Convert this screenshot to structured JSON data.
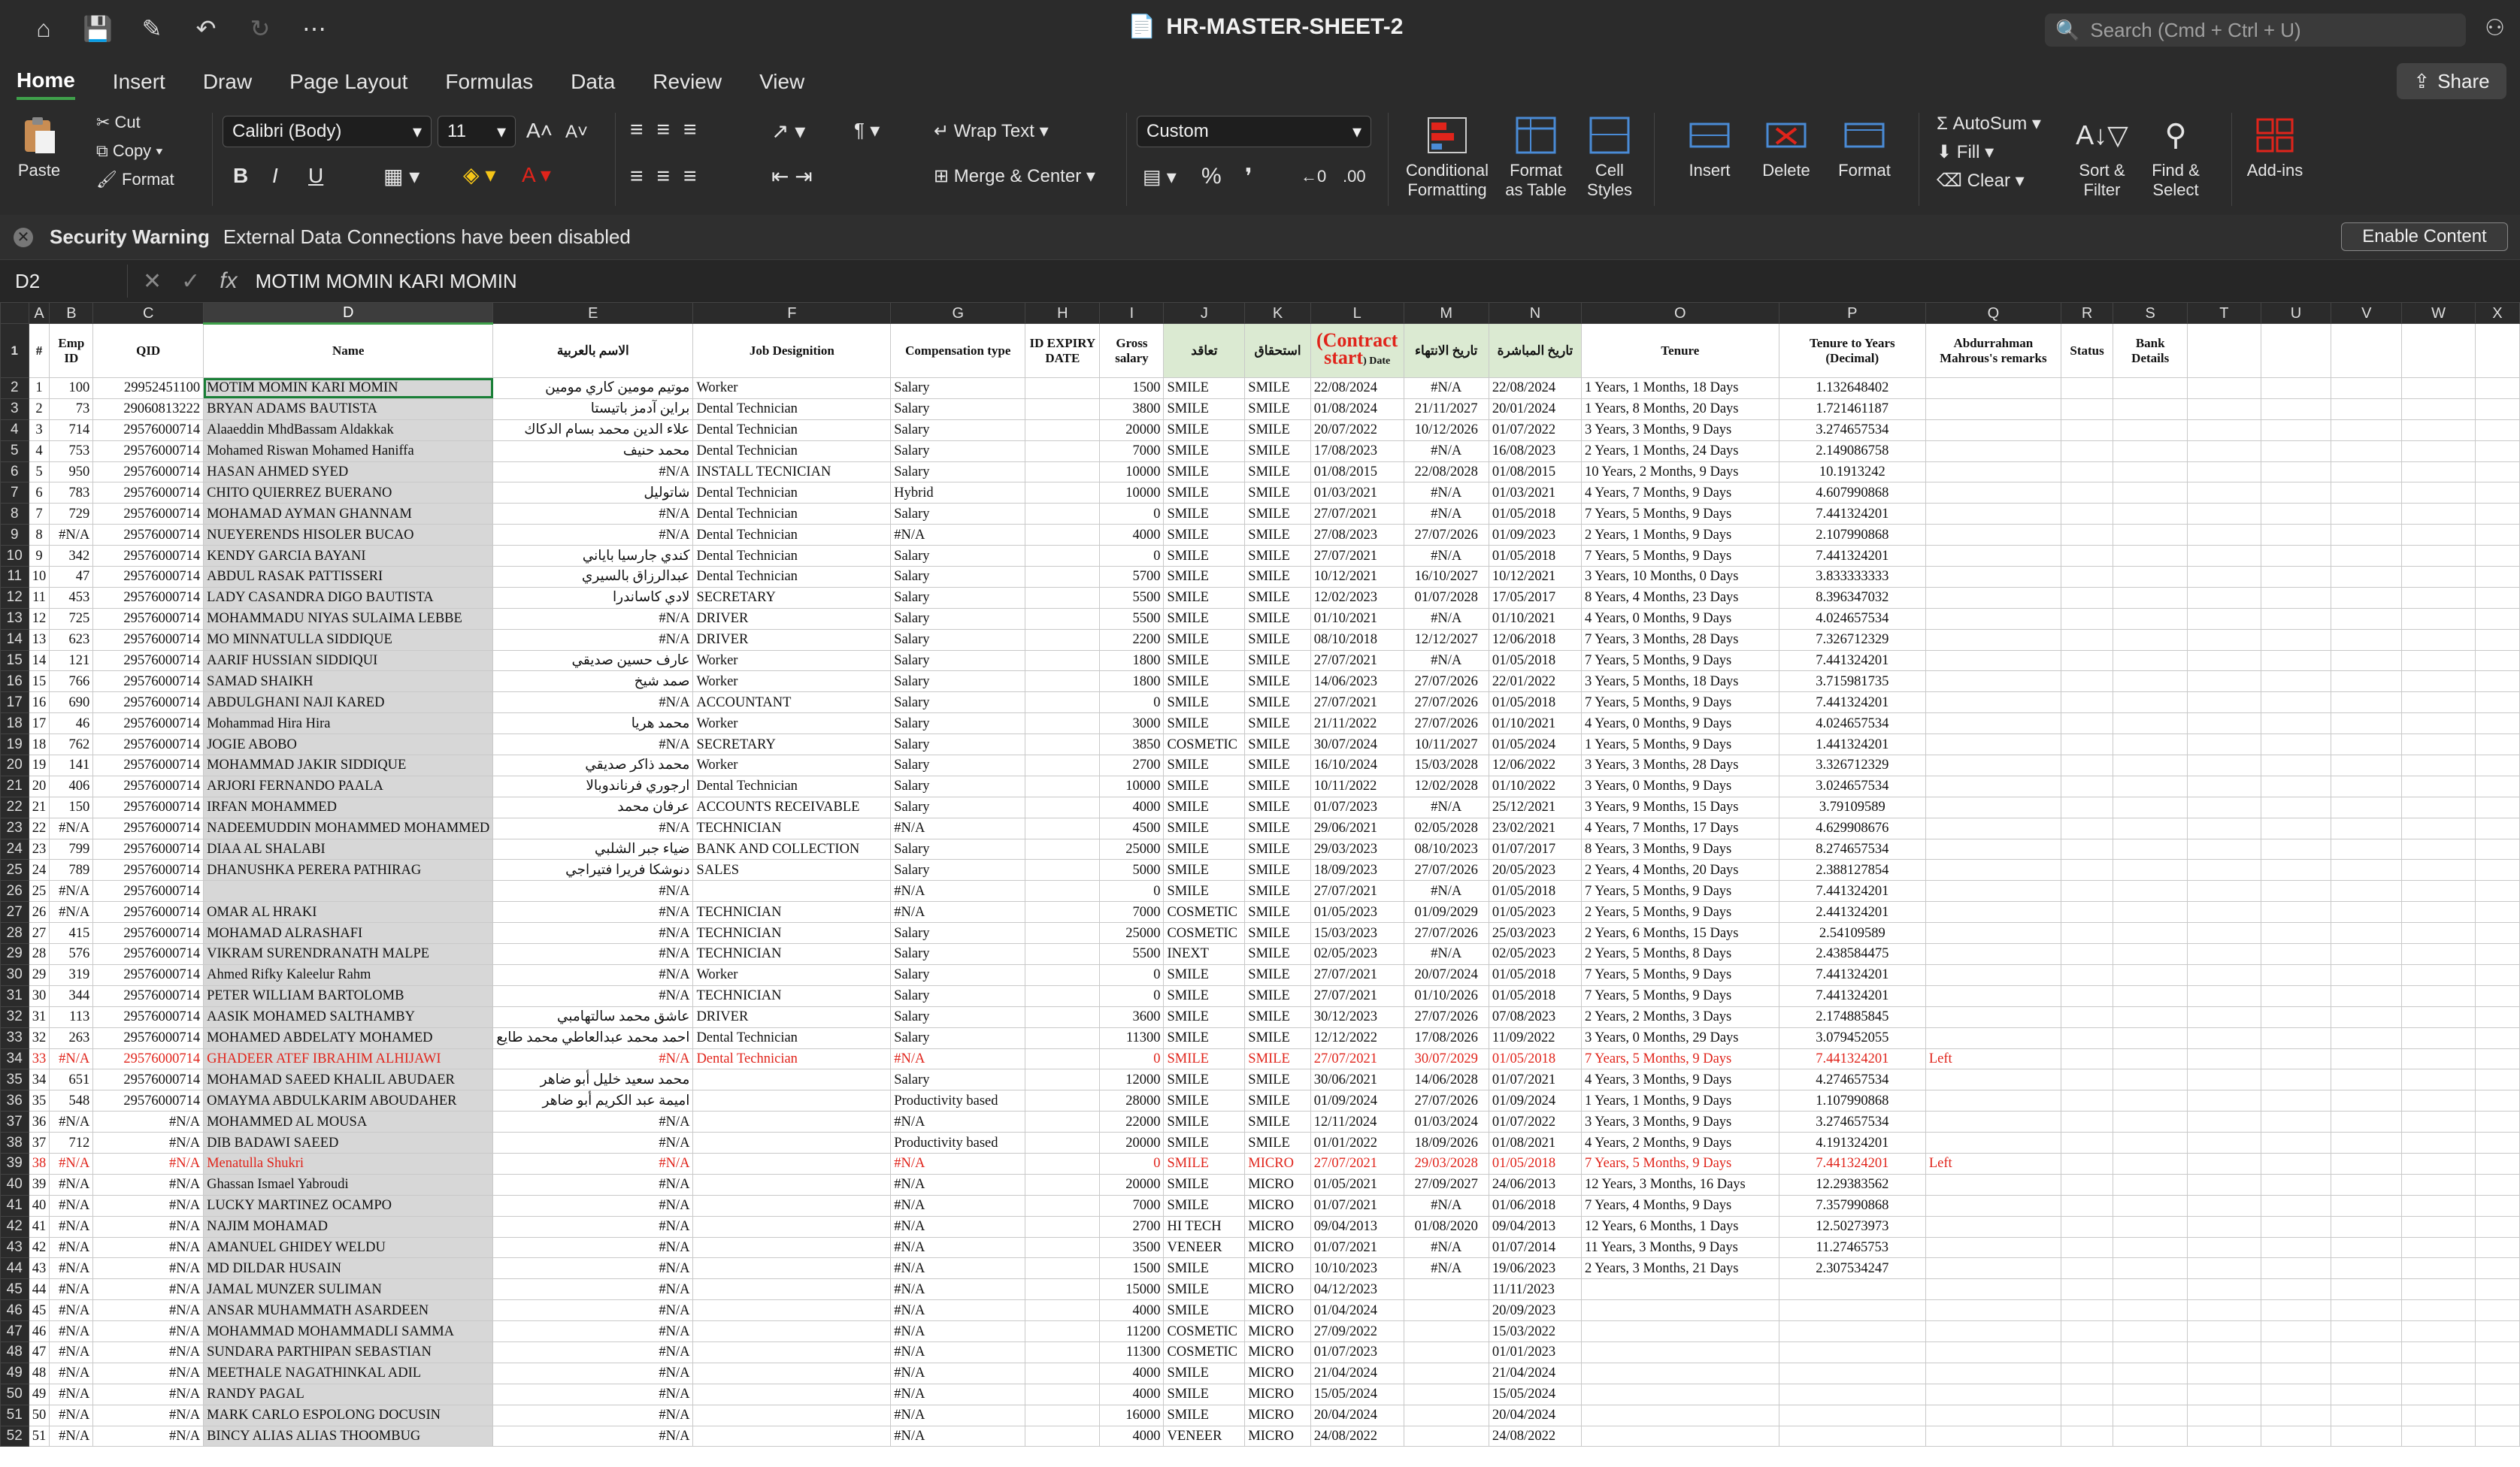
{
  "window": {
    "title": "HR-MASTER-SHEET-2",
    "search_placeholder": "Search (Cmd + Ctrl + U)"
  },
  "menu_tabs": [
    "Home",
    "Insert",
    "Draw",
    "Page Layout",
    "Formulas",
    "Data",
    "Review",
    "View"
  ],
  "share_label": "Share",
  "ribbon": {
    "paste": "Paste",
    "cut": "Cut",
    "copy": "Copy",
    "format_painter": "Format",
    "font_name": "Calibri (Body)",
    "font_size": "11",
    "wrap_text": "Wrap Text",
    "merge_center": "Merge & Center",
    "number_format": "Custom",
    "conditional_formatting": "Conditional Formatting",
    "format_as_table": "Format as Table",
    "cell_styles": "Cell Styles",
    "insert": "Insert",
    "delete": "Delete",
    "format": "Format",
    "autosum": "AutoSum",
    "fill": "Fill",
    "clear": "Clear",
    "sort_filter": "Sort & Filter",
    "find_select": "Find & Select",
    "addins": "Add-ins",
    "bold": "B",
    "italic": "I",
    "underline": "U"
  },
  "security": {
    "title": "Security Warning",
    "message": "External Data Connections have been disabled",
    "button": "Enable Content"
  },
  "formula_bar": {
    "cell": "D2",
    "formula": "MOTIM MOMIN KARI MOMIN"
  },
  "columns": [
    "A",
    "B",
    "C",
    "D",
    "E",
    "F",
    "G",
    "H",
    "I",
    "J",
    "K",
    "L",
    "M",
    "N",
    "O",
    "P",
    "Q",
    "R",
    "S",
    "T",
    "U",
    "V",
    "W",
    "X"
  ],
  "headers": {
    "A": "#",
    "B": "Emp ID",
    "C": "QID",
    "D": "Name",
    "E": "الاسم بالعربية",
    "F": "Job Designition",
    "G": "Compensation type",
    "H": "ID EXPIRY DATE",
    "I": "Gross salary",
    "J": "تعاقد",
    "K": "استحقاق",
    "L_big": "(Contract start",
    "L_small": ") Date",
    "M": "تاريخ الانتهاء",
    "N": "تاريخ المباشرة",
    "O": "Tenure",
    "P": "Tenure to Years (Decimal)",
    "Q": "Abdurrahman Mahrous's remarks",
    "R": "Status",
    "S": "Bank Details"
  },
  "rows": [
    [
      "1",
      "100",
      "29952451100",
      "MOTIM MOMIN KARI MOMIN",
      "موتيم مومين كاري مومين",
      "Worker",
      "Salary",
      "",
      "1500",
      "SMILE",
      "SMILE",
      "22/08/2024",
      "#N/A",
      "22/08/2024",
      "1 Years, 1 Months, 18 Days",
      "1.132648402",
      "",
      "",
      ""
    ],
    [
      "2",
      "73",
      "29060813222",
      "BRYAN ADAMS BAUTISTA",
      "براين آدمز باتيستا",
      "Dental Technician",
      "Salary",
      "",
      "3800",
      "SMILE",
      "SMILE",
      "01/08/2024",
      "21/11/2027",
      "20/01/2024",
      "1 Years, 8 Months, 20 Days",
      "1.721461187",
      "",
      "",
      ""
    ],
    [
      "3",
      "714",
      "29576000714",
      "Alaaeddin MhdBassam Aldakkak",
      "علاء الدين محمد بسام الدكاك",
      "Dental Technician",
      "Salary",
      "",
      "20000",
      "SMILE",
      "SMILE",
      "20/07/2022",
      "10/12/2026",
      "01/07/2022",
      "3 Years, 3 Months, 9 Days",
      "3.274657534",
      "",
      "",
      ""
    ],
    [
      "4",
      "753",
      "29576000714",
      "Mohamed Riswan Mohamed Haniffa",
      "محمد حنيف",
      "Dental Technician",
      "Salary",
      "",
      "7000",
      "SMILE",
      "SMILE",
      "17/08/2023",
      "#N/A",
      "16/08/2023",
      "2 Years, 1 Months, 24 Days",
      "2.149086758",
      "",
      "",
      ""
    ],
    [
      "5",
      "950",
      "29576000714",
      "HASAN AHMED SYED",
      "#N/A",
      "INSTALL TECNICIAN",
      "Salary",
      "",
      "10000",
      "SMILE",
      "SMILE",
      "01/08/2015",
      "22/08/2028",
      "01/08/2015",
      "10 Years, 2 Months, 9 Days",
      "10.1913242",
      "",
      "",
      ""
    ],
    [
      "6",
      "783",
      "29576000714",
      "CHITO QUIERREZ BUERANO",
      "شاتوليل",
      "Dental Technician",
      "Hybrid",
      "",
      "10000",
      "SMILE",
      "SMILE",
      "01/03/2021",
      "#N/A",
      "01/03/2021",
      "4 Years, 7 Months, 9 Days",
      "4.607990868",
      "",
      "",
      ""
    ],
    [
      "7",
      "729",
      "29576000714",
      "MOHAMAD AYMAN GHANNAM",
      "#N/A",
      "Dental Technician",
      "Salary",
      "",
      "0",
      "SMILE",
      "SMILE",
      "27/07/2021",
      "#N/A",
      "01/05/2018",
      "7 Years, 5 Months, 9 Days",
      "7.441324201",
      "",
      "",
      ""
    ],
    [
      "8",
      "#N/A",
      "29576000714",
      "NUEYERENDS HISOLER BUCAO",
      "#N/A",
      "Dental Technician",
      "#N/A",
      "",
      "4000",
      "SMILE",
      "SMILE",
      "27/08/2023",
      "27/07/2026",
      "01/09/2023",
      "2 Years, 1 Months, 9 Days",
      "2.107990868",
      "",
      "",
      ""
    ],
    [
      "9",
      "342",
      "29576000714",
      "KENDY GARCIA BAYANI",
      "كندي جارسيا باياني",
      "Dental Technician",
      "Salary",
      "",
      "0",
      "SMILE",
      "SMILE",
      "27/07/2021",
      "#N/A",
      "01/05/2018",
      "7 Years, 5 Months, 9 Days",
      "7.441324201",
      "",
      "",
      ""
    ],
    [
      "10",
      "47",
      "29576000714",
      "ABDUL RASAK PATTISSERI",
      "عبدالرزاق بالسيري",
      "Dental Technician",
      "Salary",
      "",
      "5700",
      "SMILE",
      "SMILE",
      "10/12/2021",
      "16/10/2027",
      "10/12/2021",
      "3 Years, 10 Months, 0 Days",
      "3.833333333",
      "",
      "",
      ""
    ],
    [
      "11",
      "453",
      "29576000714",
      "LADY CASANDRA DIGO BAUTISTA",
      "لادي كاساندرا",
      "SECRETARY",
      "Salary",
      "",
      "5500",
      "SMILE",
      "SMILE",
      "12/02/2023",
      "01/07/2028",
      "17/05/2017",
      "8 Years, 4 Months, 23 Days",
      "8.396347032",
      "",
      "",
      ""
    ],
    [
      "12",
      "725",
      "29576000714",
      "MOHAMMADU NIYAS SULAIMA LEBBE",
      "#N/A",
      "DRIVER",
      "Salary",
      "",
      "5500",
      "SMILE",
      "SMILE",
      "01/10/2021",
      "#N/A",
      "01/10/2021",
      "4 Years, 0 Months, 9 Days",
      "4.024657534",
      "",
      "",
      ""
    ],
    [
      "13",
      "623",
      "29576000714",
      "MO MINNATULLA SIDDIQUE",
      "#N/A",
      "DRIVER",
      "Salary",
      "",
      "2200",
      "SMILE",
      "SMILE",
      "08/10/2018",
      "12/12/2027",
      "12/06/2018",
      "7 Years, 3 Months, 28 Days",
      "7.326712329",
      "",
      "",
      ""
    ],
    [
      "14",
      "121",
      "29576000714",
      "AARIF HUSSIAN SIDDIQUI",
      "عارف حسين صديقي",
      "Worker",
      "Salary",
      "",
      "1800",
      "SMILE",
      "SMILE",
      "27/07/2021",
      "#N/A",
      "01/05/2018",
      "7 Years, 5 Months, 9 Days",
      "7.441324201",
      "",
      "",
      ""
    ],
    [
      "15",
      "766",
      "29576000714",
      "SAMAD SHAIKH",
      "صمد شيخ",
      "Worker",
      "Salary",
      "",
      "1800",
      "SMILE",
      "SMILE",
      "14/06/2023",
      "27/07/2026",
      "22/01/2022",
      "3 Years, 5 Months, 18 Days",
      "3.715981735",
      "",
      "",
      ""
    ],
    [
      "16",
      "690",
      "29576000714",
      "ABDULGHANI NAJI KARED",
      "#N/A",
      "ACCOUNTANT",
      "Salary",
      "",
      "0",
      "SMILE",
      "SMILE",
      "27/07/2021",
      "27/07/2026",
      "01/05/2018",
      "7 Years, 5 Months, 9 Days",
      "7.441324201",
      "",
      "",
      ""
    ],
    [
      "17",
      "46",
      "29576000714",
      "Mohammad Hira Hira",
      "محمد هريا",
      "Worker",
      "Salary",
      "",
      "3000",
      "SMILE",
      "SMILE",
      "21/11/2022",
      "27/07/2026",
      "01/10/2021",
      "4 Years, 0 Months, 9 Days",
      "4.024657534",
      "",
      "",
      ""
    ],
    [
      "18",
      "762",
      "29576000714",
      "JOGIE ABOBO",
      "#N/A",
      "SECRETARY",
      "Salary",
      "",
      "3850",
      "COSMETIC",
      "SMILE",
      "30/07/2024",
      "10/11/2027",
      "01/05/2024",
      "1 Years, 5 Months, 9 Days",
      "1.441324201",
      "",
      "",
      ""
    ],
    [
      "19",
      "141",
      "29576000714",
      "MOHAMMAD JAKIR SIDDIQUE",
      "محمد ذاكر صديقي",
      "Worker",
      "Salary",
      "",
      "2700",
      "SMILE",
      "SMILE",
      "16/10/2024",
      "15/03/2028",
      "12/06/2022",
      "3 Years, 3 Months, 28 Days",
      "3.326712329",
      "",
      "",
      ""
    ],
    [
      "20",
      "406",
      "29576000714",
      "ARJORI FERNANDO PAALA",
      "ارجوري فرناندوبالا",
      "Dental Technician",
      "Salary",
      "",
      "10000",
      "SMILE",
      "SMILE",
      "10/11/2022",
      "12/02/2028",
      "01/10/2022",
      "3 Years, 0 Months, 9 Days",
      "3.024657534",
      "",
      "",
      ""
    ],
    [
      "21",
      "150",
      "29576000714",
      "IRFAN MOHAMMED",
      "عرفان محمد",
      "ACCOUNTS RECEIVABLE",
      "Salary",
      "",
      "4000",
      "SMILE",
      "SMILE",
      "01/07/2023",
      "#N/A",
      "25/12/2021",
      "3 Years, 9 Months, 15 Days",
      "3.79109589",
      "",
      "",
      ""
    ],
    [
      "22",
      "#N/A",
      "29576000714",
      "NADEEMUDDIN MOHAMMED MOHAMMED",
      "#N/A",
      "TECHNICIAN",
      "#N/A",
      "",
      "4500",
      "SMILE",
      "SMILE",
      "29/06/2021",
      "02/05/2028",
      "23/02/2021",
      "4 Years, 7 Months, 17 Days",
      "4.629908676",
      "",
      "",
      ""
    ],
    [
      "23",
      "799",
      "29576000714",
      "DIAA AL SHALABI",
      "ضياء جبر الشلبي",
      "BANK AND COLLECTION",
      "Salary",
      "",
      "25000",
      "SMILE",
      "SMILE",
      "29/03/2023",
      "08/10/2023",
      "01/07/2017",
      "8 Years, 3 Months, 9 Days",
      "8.274657534",
      "",
      "",
      ""
    ],
    [
      "24",
      "789",
      "29576000714",
      "DHANUSHKA PERERA PATHIRAG",
      "دنوشكا فريرا فتيراجي",
      "SALES",
      "Salary",
      "",
      "5000",
      "SMILE",
      "SMILE",
      "18/09/2023",
      "27/07/2026",
      "20/05/2023",
      "2 Years, 4 Months, 20 Days",
      "2.388127854",
      "",
      "",
      ""
    ],
    [
      "25",
      "#N/A",
      "29576000714",
      "",
      "#N/A",
      "",
      "#N/A",
      "",
      "0",
      "SMILE",
      "SMILE",
      "27/07/2021",
      "#N/A",
      "01/05/2018",
      "7 Years, 5 Months, 9 Days",
      "7.441324201",
      "",
      "",
      ""
    ],
    [
      "26",
      "#N/A",
      "29576000714",
      "OMAR AL HRAKI",
      "#N/A",
      "TECHNICIAN",
      "#N/A",
      "",
      "7000",
      "COSMETIC",
      "SMILE",
      "01/05/2023",
      "01/09/2029",
      "01/05/2023",
      "2 Years, 5 Months, 9 Days",
      "2.441324201",
      "",
      "",
      ""
    ],
    [
      "27",
      "415",
      "29576000714",
      "MOHAMAD ALRASHAFI",
      "#N/A",
      "TECHNICIAN",
      "Salary",
      "",
      "25000",
      "COSMETIC",
      "SMILE",
      "15/03/2023",
      "27/07/2026",
      "25/03/2023",
      "2 Years, 6 Months, 15 Days",
      "2.54109589",
      "",
      "",
      ""
    ],
    [
      "28",
      "576",
      "29576000714",
      "VIKRAM SURENDRANATH MALPE",
      "#N/A",
      "TECHNICIAN",
      "Salary",
      "",
      "5500",
      "INEXT",
      "SMILE",
      "02/05/2023",
      "#N/A",
      "02/05/2023",
      "2 Years, 5 Months, 8 Days",
      "2.438584475",
      "",
      "",
      ""
    ],
    [
      "29",
      "319",
      "29576000714",
      "Ahmed Rifky Kaleelur Rahm",
      "#N/A",
      "Worker",
      "Salary",
      "",
      "0",
      "SMILE",
      "SMILE",
      "27/07/2021",
      "20/07/2024",
      "01/05/2018",
      "7 Years, 5 Months, 9 Days",
      "7.441324201",
      "",
      "",
      ""
    ],
    [
      "30",
      "344",
      "29576000714",
      "PETER WILLIAM BARTOLOMB",
      "#N/A",
      "TECHNICIAN",
      "Salary",
      "",
      "0",
      "SMILE",
      "SMILE",
      "27/07/2021",
      "01/10/2026",
      "01/05/2018",
      "7 Years, 5 Months, 9 Days",
      "7.441324201",
      "",
      "",
      ""
    ],
    [
      "31",
      "113",
      "29576000714",
      "AASIK MOHAMED SALTHAMBY",
      "عاشق محمد سالتهامبي",
      "DRIVER",
      "Salary",
      "",
      "3600",
      "SMILE",
      "SMILE",
      "30/12/2023",
      "27/07/2026",
      "07/08/2023",
      "2 Years, 2 Months, 3 Days",
      "2.174885845",
      "",
      "",
      ""
    ],
    [
      "32",
      "263",
      "29576000714",
      "MOHAMED ABDELATY MOHAMED",
      "احمد محمد عبدالعاطي محمد طايع",
      "Dental Technician",
      "Salary",
      "",
      "11300",
      "SMILE",
      "SMILE",
      "12/12/2022",
      "17/08/2026",
      "11/09/2022",
      "3 Years, 0 Months, 29 Days",
      "3.079452055",
      "",
      "",
      ""
    ],
    [
      "33",
      "#N/A",
      "29576000714",
      "GHADEER ATEF IBRAHIM ALHIJAWI",
      "#N/A",
      "Dental Technician",
      "#N/A",
      "",
      "0",
      "SMILE",
      "SMILE",
      "27/07/2021",
      "30/07/2029",
      "01/05/2018",
      "7 Years, 5 Months, 9 Days",
      "7.441324201",
      "Left",
      "",
      ""
    ],
    [
      "34",
      "651",
      "29576000714",
      "MOHAMAD SAEED KHALIL ABUDAER",
      "محمد سعيد خليل أبو ضاهر",
      "",
      "Salary",
      "",
      "12000",
      "SMILE",
      "SMILE",
      "30/06/2021",
      "14/06/2028",
      "01/07/2021",
      "4 Years, 3 Months, 9 Days",
      "4.274657534",
      "",
      "",
      ""
    ],
    [
      "35",
      "548",
      "29576000714",
      "OMAYMA ABDULKARIM ABOUDAHER",
      "اميمة عبد الكريم أبو ضاهر",
      "",
      "Productivity based",
      "",
      "28000",
      "SMILE",
      "SMILE",
      "01/09/2024",
      "27/07/2026",
      "01/09/2024",
      "1 Years, 1 Months, 9 Days",
      "1.107990868",
      "",
      "",
      ""
    ],
    [
      "36",
      "#N/A",
      "#N/A",
      "MOHAMMED AL MOUSA",
      "#N/A",
      "",
      "#N/A",
      "",
      "22000",
      "SMILE",
      "SMILE",
      "12/11/2024",
      "01/03/2024",
      "01/07/2022",
      "3 Years, 3 Months, 9 Days",
      "3.274657534",
      "",
      "",
      ""
    ],
    [
      "37",
      "712",
      "#N/A",
      "DIB BADAWI SAEED",
      "#N/A",
      "",
      "Productivity based",
      "",
      "20000",
      "SMILE",
      "SMILE",
      "01/01/2022",
      "18/09/2026",
      "01/08/2021",
      "4 Years, 2 Months, 9 Days",
      "4.191324201",
      "",
      "",
      ""
    ],
    [
      "38",
      "#N/A",
      "#N/A",
      "Menatulla Shukri",
      "#N/A",
      "",
      "#N/A",
      "",
      "0",
      "SMILE",
      "MICRO",
      "27/07/2021",
      "29/03/2028",
      "01/05/2018",
      "7 Years, 5 Months, 9 Days",
      "7.441324201",
      "Left",
      "",
      ""
    ],
    [
      "39",
      "#N/A",
      "#N/A",
      "Ghassan Ismael Yabroudi",
      "#N/A",
      "",
      "#N/A",
      "",
      "20000",
      "SMILE",
      "MICRO",
      "01/05/2021",
      "27/09/2027",
      "24/06/2013",
      "12 Years, 3 Months, 16 Days",
      "12.29383562",
      "",
      "",
      ""
    ],
    [
      "40",
      "#N/A",
      "#N/A",
      "LUCKY MARTINEZ OCAMPO",
      "#N/A",
      "",
      "#N/A",
      "",
      "7000",
      "SMILE",
      "MICRO",
      "01/07/2021",
      "#N/A",
      "01/06/2018",
      "7 Years, 4 Months, 9 Days",
      "7.357990868",
      "",
      "",
      ""
    ],
    [
      "41",
      "#N/A",
      "#N/A",
      "NAJIM MOHAMAD",
      "#N/A",
      "",
      "#N/A",
      "",
      "2700",
      "HI TECH",
      "MICRO",
      "09/04/2013",
      "01/08/2020",
      "09/04/2013",
      "12 Years, 6 Months, 1 Days",
      "12.50273973",
      "",
      "",
      ""
    ],
    [
      "42",
      "#N/A",
      "#N/A",
      "AMANUEL GHIDEY WELDU",
      "#N/A",
      "",
      "#N/A",
      "",
      "3500",
      "VENEER",
      "MICRO",
      "01/07/2021",
      "#N/A",
      "01/07/2014",
      "11 Years, 3 Months, 9 Days",
      "11.27465753",
      "",
      "",
      ""
    ],
    [
      "43",
      "#N/A",
      "#N/A",
      "MD DILDAR HUSAIN",
      "#N/A",
      "",
      "#N/A",
      "",
      "1500",
      "SMILE",
      "MICRO",
      "10/10/2023",
      "#N/A",
      "19/06/2023",
      "2 Years, 3 Months, 21 Days",
      "2.307534247",
      "",
      "",
      ""
    ],
    [
      "44",
      "#N/A",
      "#N/A",
      "JAMAL MUNZER SULIMAN",
      "#N/A",
      "",
      "#N/A",
      "",
      "15000",
      "SMILE",
      "MICRO",
      "04/12/2023",
      "",
      "11/11/2023",
      "",
      "",
      "",
      "",
      ""
    ],
    [
      "45",
      "#N/A",
      "#N/A",
      "ANSAR MUHAMMATH ASARDEEN",
      "#N/A",
      "",
      "#N/A",
      "",
      "4000",
      "SMILE",
      "MICRO",
      "01/04/2024",
      "",
      "20/09/2023",
      "",
      "",
      "",
      "",
      ""
    ],
    [
      "46",
      "#N/A",
      "#N/A",
      "MOHAMMAD MOHAMMADLI SAMMA",
      "#N/A",
      "",
      "#N/A",
      "",
      "11200",
      "COSMETIC",
      "MICRO",
      "27/09/2022",
      "",
      "15/03/2022",
      "",
      "",
      "",
      "",
      ""
    ],
    [
      "47",
      "#N/A",
      "#N/A",
      "SUNDARA PARTHIPAN SEBASTIAN",
      "#N/A",
      "",
      "#N/A",
      "",
      "11300",
      "COSMETIC",
      "MICRO",
      "01/07/2023",
      "",
      "01/01/2023",
      "",
      "",
      "",
      "",
      ""
    ],
    [
      "48",
      "#N/A",
      "#N/A",
      "MEETHALE NAGATHINKAL ADIL",
      "#N/A",
      "",
      "#N/A",
      "",
      "4000",
      "SMILE",
      "MICRO",
      "21/04/2024",
      "",
      "21/04/2024",
      "",
      "",
      "",
      "",
      ""
    ],
    [
      "49",
      "#N/A",
      "#N/A",
      "RANDY PAGAL",
      "#N/A",
      "",
      "#N/A",
      "",
      "4000",
      "SMILE",
      "MICRO",
      "15/05/2024",
      "",
      "15/05/2024",
      "",
      "",
      "",
      "",
      ""
    ],
    [
      "50",
      "#N/A",
      "#N/A",
      "MARK CARLO ESPOLONG DOCUSIN",
      "#N/A",
      "",
      "#N/A",
      "",
      "16000",
      "SMILE",
      "MICRO",
      "20/04/2024",
      "",
      "20/04/2024",
      "",
      "",
      "",
      "",
      ""
    ],
    [
      "51",
      "#N/A",
      "#N/A",
      "BINCY ALIAS ALIAS THOOMBUG",
      "#N/A",
      "",
      "#N/A",
      "",
      "4000",
      "VENEER",
      "MICRO",
      "24/08/2022",
      "",
      "24/08/2022",
      "",
      "",
      "",
      "",
      ""
    ]
  ],
  "red_rows": [
    33,
    38
  ]
}
